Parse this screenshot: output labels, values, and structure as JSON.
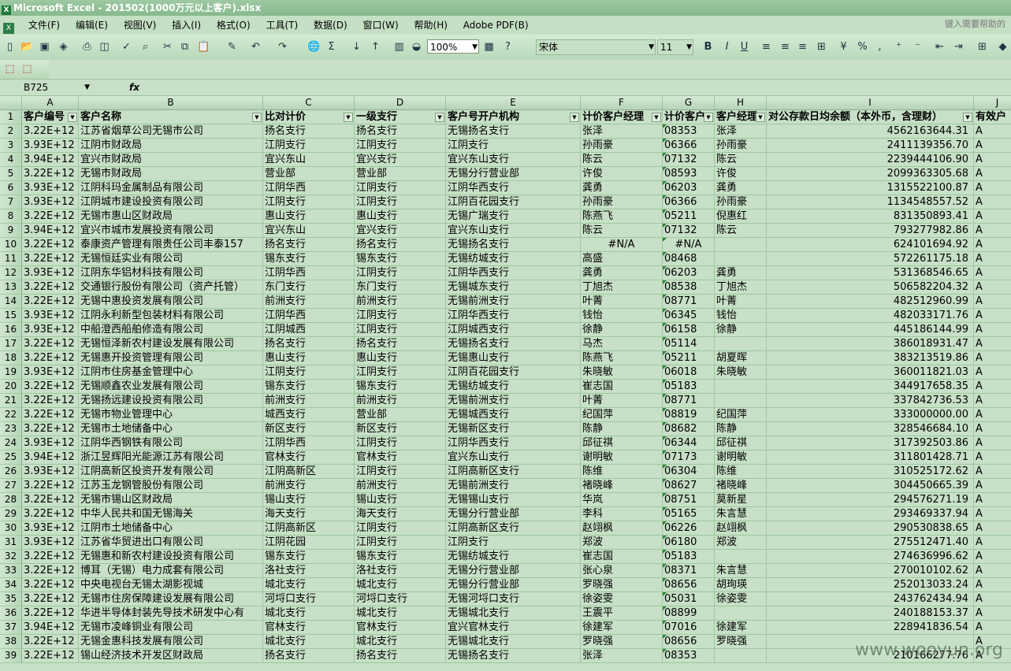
{
  "window": {
    "title": "Microsoft Excel - 201502(1000万元以上客户).xlsx"
  },
  "menu": [
    "文件(F)",
    "编辑(E)",
    "视图(V)",
    "插入(I)",
    "格式(O)",
    "工具(T)",
    "数据(D)",
    "窗口(W)",
    "帮助(H)",
    "Adobe PDF(B)"
  ],
  "help_box": "键入需要帮助的",
  "toolbar": {
    "zoom": "100%",
    "font": "宋体",
    "font_size": "11"
  },
  "formula_bar": {
    "name_box": "B725",
    "fx": "fx"
  },
  "columns": [
    "A",
    "B",
    "C",
    "D",
    "E",
    "F",
    "G",
    "H",
    "I",
    "J"
  ],
  "header_row": {
    "row_number": "1",
    "cells": [
      "客户编号",
      "客户名称",
      "比对计价",
      "一级支行",
      "客户号开户机构",
      "计价客户经理",
      "计价客户",
      "客户经理",
      "对公存款日均余额（本外币，含理财）",
      "有效户"
    ]
  },
  "rows": [
    {
      "n": "2",
      "a": "3.22E+12",
      "b": "江苏省烟草公司无锡市公司",
      "c": "扬名支行",
      "d": "扬名支行",
      "e": "无锡扬名支行",
      "f": "张泽",
      "g": "08353",
      "h": "张泽",
      "i": "4562163644.31",
      "j": "A"
    },
    {
      "n": "3",
      "a": "3.93E+12",
      "b": "江阴市财政局",
      "c": "江阴支行",
      "d": "江阴支行",
      "e": "江阴支行",
      "f": "孙雨豪",
      "g": "06366",
      "h": "孙雨豪",
      "i": "2411139356.70",
      "j": "A"
    },
    {
      "n": "4",
      "a": "3.94E+12",
      "b": "宜兴市财政局",
      "c": "宜兴东山",
      "d": "宜兴支行",
      "e": "宜兴东山支行",
      "f": "陈云",
      "g": "07132",
      "h": "陈云",
      "i": "2239444106.90",
      "j": "A"
    },
    {
      "n": "5",
      "a": "3.22E+12",
      "b": "无锡市财政局",
      "c": "营业部",
      "d": "营业部",
      "e": "无锡分行营业部",
      "f": "许俊",
      "g": "08593",
      "h": "许俊",
      "i": "2099363305.68",
      "j": "A"
    },
    {
      "n": "6",
      "a": "3.93E+12",
      "b": "江阴科玛金属制品有限公司",
      "c": "江阴华西",
      "d": "江阴支行",
      "e": "江阴华西支行",
      "f": "龚勇",
      "g": "06203",
      "h": "龚勇",
      "i": "1315522100.87",
      "j": "A"
    },
    {
      "n": "7",
      "a": "3.93E+12",
      "b": "江阴城市建设投资有限公司",
      "c": "江阴支行",
      "d": "江阴支行",
      "e": "江阴百花园支行",
      "f": "孙雨豪",
      "g": "06366",
      "h": "孙雨豪",
      "i": "1134548557.52",
      "j": "A"
    },
    {
      "n": "8",
      "a": "3.22E+12",
      "b": "无锡市惠山区财政局",
      "c": "惠山支行",
      "d": "惠山支行",
      "e": "无锡广瑞支行",
      "f": "陈燕飞",
      "g": "05211",
      "h": "倪惠红",
      "i": "831350893.41",
      "j": "A"
    },
    {
      "n": "9",
      "a": "3.94E+12",
      "b": "宜兴市城市发展投资有限公司",
      "c": "宜兴东山",
      "d": "宜兴支行",
      "e": "宜兴东山支行",
      "f": "陈云",
      "g": "07132",
      "h": "陈云",
      "i": "793277982.86",
      "j": "A"
    },
    {
      "n": "10",
      "a": "3.22E+12",
      "b": "泰康资产管理有限责任公司丰泰157",
      "c": "扬名支行",
      "d": "扬名支行",
      "e": "无锡扬名支行",
      "f": "#N/A",
      "g": "#N/A",
      "h": "",
      "i": "624101694.92",
      "j": "A"
    },
    {
      "n": "11",
      "a": "3.22E+12",
      "b": "无锡恒廷实业有限公司",
      "c": "锡东支行",
      "d": "锡东支行",
      "e": "无锡纺城支行",
      "f": "高盛",
      "g": "08468",
      "h": "",
      "i": "572261175.18",
      "j": "A"
    },
    {
      "n": "12",
      "a": "3.93E+12",
      "b": "江阴东华铝材科技有限公司",
      "c": "江阴华西",
      "d": "江阴支行",
      "e": "江阴华西支行",
      "f": "龚勇",
      "g": "06203",
      "h": "龚勇",
      "i": "531368546.65",
      "j": "A"
    },
    {
      "n": "13",
      "a": "3.22E+12",
      "b": "交通银行股份有限公司（资产托管）",
      "c": "东门支行",
      "d": "东门支行",
      "e": "无锡城东支行",
      "f": "丁旭杰",
      "g": "08538",
      "h": "丁旭杰",
      "i": "506582204.32",
      "j": "A"
    },
    {
      "n": "14",
      "a": "3.22E+12",
      "b": "无锡中惠投资发展有限公司",
      "c": "前洲支行",
      "d": "前洲支行",
      "e": "无锡前洲支行",
      "f": "叶菁",
      "g": "08771",
      "h": "叶菁",
      "i": "482512960.99",
      "j": "A"
    },
    {
      "n": "15",
      "a": "3.93E+12",
      "b": "江阴永利新型包装材料有限公司",
      "c": "江阴华西",
      "d": "江阴支行",
      "e": "江阴华西支行",
      "f": "钱怡",
      "g": "06345",
      "h": "钱怡",
      "i": "482033171.76",
      "j": "A"
    },
    {
      "n": "16",
      "a": "3.93E+12",
      "b": "中船澄西船舶修造有限公司",
      "c": "江阴城西",
      "d": "江阴支行",
      "e": "江阴城西支行",
      "f": "徐静",
      "g": "06158",
      "h": "徐静",
      "i": "445186144.99",
      "j": "A"
    },
    {
      "n": "17",
      "a": "3.22E+12",
      "b": "无锡恒泽新农村建设发展有限公司",
      "c": "扬名支行",
      "d": "扬名支行",
      "e": "无锡扬名支行",
      "f": "马杰",
      "g": "05114",
      "h": "",
      "i": "386018931.47",
      "j": "A"
    },
    {
      "n": "18",
      "a": "3.22E+12",
      "b": "无锡惠开投资管理有限公司",
      "c": "惠山支行",
      "d": "惠山支行",
      "e": "无锡惠山支行",
      "f": "陈燕飞",
      "g": "05211",
      "h": "胡夏晖",
      "i": "383213519.86",
      "j": "A"
    },
    {
      "n": "19",
      "a": "3.93E+12",
      "b": "江阴市住房基金管理中心",
      "c": "江阴支行",
      "d": "江阴支行",
      "e": "江阴百花园支行",
      "f": "朱晓敏",
      "g": "06018",
      "h": "朱晓敏",
      "i": "360011821.03",
      "j": "A"
    },
    {
      "n": "20",
      "a": "3.22E+12",
      "b": "无锡顺鑫农业发展有限公司",
      "c": "锡东支行",
      "d": "锡东支行",
      "e": "无锡纺城支行",
      "f": "崔志国",
      "g": "05183",
      "h": "",
      "i": "344917658.35",
      "j": "A"
    },
    {
      "n": "21",
      "a": "3.22E+12",
      "b": "无锡扬远建设投资有限公司",
      "c": "前洲支行",
      "d": "前洲支行",
      "e": "无锡前洲支行",
      "f": "叶菁",
      "g": "08771",
      "h": "",
      "i": "337842736.53",
      "j": "A"
    },
    {
      "n": "22",
      "a": "3.22E+12",
      "b": "无锡市物业管理中心",
      "c": "城西支行",
      "d": "营业部",
      "e": "无锡城西支行",
      "f": "纪国萍",
      "g": "08819",
      "h": "纪国萍",
      "i": "333000000.00",
      "j": "A"
    },
    {
      "n": "23",
      "a": "3.22E+12",
      "b": "无锡市土地储备中心",
      "c": "新区支行",
      "d": "新区支行",
      "e": "无锡新区支行",
      "f": "陈静",
      "g": "08682",
      "h": "陈静",
      "i": "328546684.10",
      "j": "A"
    },
    {
      "n": "24",
      "a": "3.93E+12",
      "b": "江阴华西钢铁有限公司",
      "c": "江阴华西",
      "d": "江阴支行",
      "e": "江阴华西支行",
      "f": "邱征祺",
      "g": "06344",
      "h": "邱征祺",
      "i": "317392503.86",
      "j": "A"
    },
    {
      "n": "25",
      "a": "3.94E+12",
      "b": "浙江昱辉阳光能源江苏有限公司",
      "c": "官林支行",
      "d": "官林支行",
      "e": "宜兴东山支行",
      "f": "谢明敏",
      "g": "07173",
      "h": "谢明敏",
      "i": "311801428.71",
      "j": "A"
    },
    {
      "n": "26",
      "a": "3.93E+12",
      "b": "江阴高新区投资开发有限公司",
      "c": "江阴高新区",
      "d": "江阴支行",
      "e": "江阴高新区支行",
      "f": "陈维",
      "g": "06304",
      "h": "陈维",
      "i": "310525172.62",
      "j": "A"
    },
    {
      "n": "27",
      "a": "3.22E+12",
      "b": "江苏玉龙钢管股份有限公司",
      "c": "前洲支行",
      "d": "前洲支行",
      "e": "无锡前洲支行",
      "f": "褚晓峰",
      "g": "08627",
      "h": "褚晓峰",
      "i": "304450665.39",
      "j": "A"
    },
    {
      "n": "28",
      "a": "3.22E+12",
      "b": "无锡市锡山区财政局",
      "c": "锡山支行",
      "d": "锡山支行",
      "e": "无锡锡山支行",
      "f": "华岚",
      "g": "08751",
      "h": "莫新星",
      "i": "294576271.19",
      "j": "A"
    },
    {
      "n": "29",
      "a": "3.22E+12",
      "b": "中华人民共和国无锡海关",
      "c": "海天支行",
      "d": "海天支行",
      "e": "无锡分行营业部",
      "f": "李科",
      "g": "05165",
      "h": "朱言慧",
      "i": "293469337.94",
      "j": "A"
    },
    {
      "n": "30",
      "a": "3.93E+12",
      "b": "江阴市土地储备中心",
      "c": "江阴高新区",
      "d": "江阴支行",
      "e": "江阴高新区支行",
      "f": "赵翊枫",
      "g": "06226",
      "h": "赵翊枫",
      "i": "290530838.65",
      "j": "A"
    },
    {
      "n": "31",
      "a": "3.93E+12",
      "b": "江苏省华贸进出口有限公司",
      "c": "江阴花园",
      "d": "江阴支行",
      "e": "江阴支行",
      "f": "郑波",
      "g": "06180",
      "h": "郑波",
      "i": "275512471.40",
      "j": "A"
    },
    {
      "n": "32",
      "a": "3.22E+12",
      "b": "无锡惠和新农村建设投资有限公司",
      "c": "锡东支行",
      "d": "锡东支行",
      "e": "无锡纺城支行",
      "f": "崔志国",
      "g": "05183",
      "h": "",
      "i": "274636996.62",
      "j": "A"
    },
    {
      "n": "33",
      "a": "3.22E+12",
      "b": "博耳（无锡）电力成套有限公司",
      "c": "洛社支行",
      "d": "洛社支行",
      "e": "无锡分行营业部",
      "f": "张心泉",
      "g": "08371",
      "h": "朱言慧",
      "i": "270010102.62",
      "j": "A"
    },
    {
      "n": "34",
      "a": "3.22E+12",
      "b": "中央电视台无锡太湖影视城",
      "c": "城北支行",
      "d": "城北支行",
      "e": "无锡分行营业部",
      "f": "罗晓强",
      "g": "08656",
      "h": "胡珣瑛",
      "i": "252013033.24",
      "j": "A"
    },
    {
      "n": "35",
      "a": "3.22E+12",
      "b": "无锡市住房保障建设发展有限公司",
      "c": "河埒口支行",
      "d": "河埒口支行",
      "e": "无锡河埒口支行",
      "f": "徐姿雯",
      "g": "05031",
      "h": "徐姿雯",
      "i": "243762434.94",
      "j": "A"
    },
    {
      "n": "36",
      "a": "3.22E+12",
      "b": "华进半导体封装先导技术研发中心有",
      "c": "城北支行",
      "d": "城北支行",
      "e": "无锡城北支行",
      "f": "王震平",
      "g": "08899",
      "h": "",
      "i": "240188153.37",
      "j": "A"
    },
    {
      "n": "37",
      "a": "3.94E+12",
      "b": "无锡市凌峰铜业有限公司",
      "c": "官林支行",
      "d": "官林支行",
      "e": "宜兴官林支行",
      "f": "徐建军",
      "g": "07016",
      "h": "徐建军",
      "i": "228941836.54",
      "j": "A"
    },
    {
      "n": "38",
      "a": "3.22E+12",
      "b": "无锡金惠科技发展有限公司",
      "c": "城北支行",
      "d": "城北支行",
      "e": "无锡城北支行",
      "f": "罗晓强",
      "g": "08656",
      "h": "罗晓强",
      "i": "",
      "j": "A"
    },
    {
      "n": "39",
      "a": "3.22E+12",
      "b": "锡山经济技术开发区财政局",
      "c": "扬名支行",
      "d": "扬名支行",
      "e": "无锡扬名支行",
      "f": "张泽",
      "g": "08353",
      "h": "",
      "i": "210166277.76",
      "j": "A"
    }
  ],
  "watermark": "www.wooyun.org"
}
